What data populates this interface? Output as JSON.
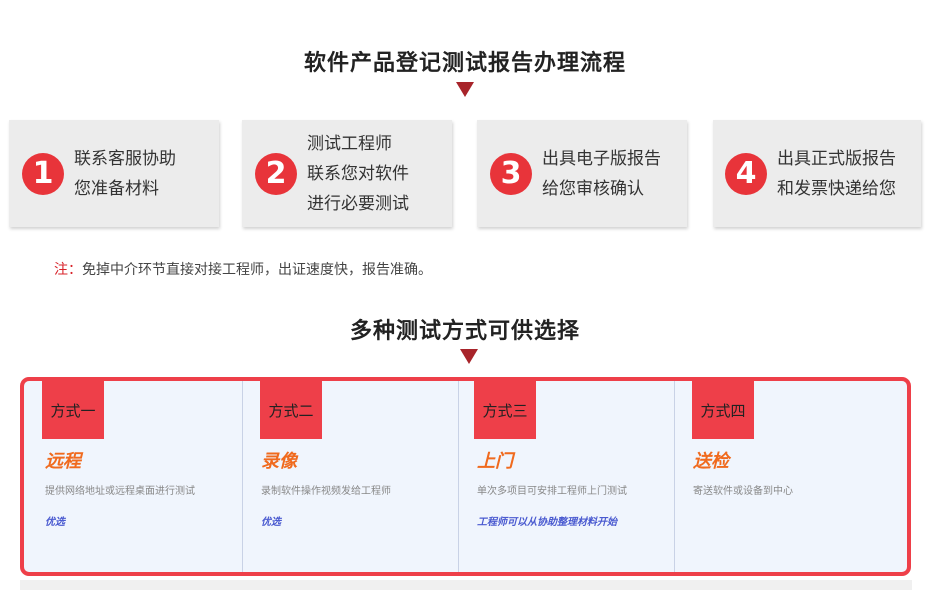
{
  "process": {
    "title": "软件产品登记测试报告办理流程",
    "steps": [
      {
        "number": "1",
        "lines": [
          "联系客服协助",
          "您准备材料"
        ]
      },
      {
        "number": "2",
        "lines": [
          "测试工程师",
          "联系您对软件",
          "进行必要测试"
        ]
      },
      {
        "number": "3",
        "lines": [
          "出具电子版报告",
          "给您审核确认"
        ]
      },
      {
        "number": "4",
        "lines": [
          "出具正式版报告",
          "和发票快递给您"
        ]
      }
    ],
    "note": {
      "mark": "注：",
      "text": "免掉中介环节直接对接工程师，出证速度快，报告准确。"
    }
  },
  "methods": {
    "title": "多种测试方式可供选择",
    "items": [
      {
        "tag": "方式一",
        "title": "远程",
        "desc": "提供网络地址或远程桌面进行测试",
        "highlight": "优选"
      },
      {
        "tag": "方式二",
        "title": "录像",
        "desc": "录制软件操作视频发给工程师",
        "highlight": "优选"
      },
      {
        "tag": "方式三",
        "title": "上门",
        "desc": "单次多项目可安排工程师上门测试",
        "highlight": "工程师可以从协助整理材料开始"
      },
      {
        "tag": "方式四",
        "title": "送检",
        "desc": "寄送软件或设备到中心",
        "highlight": ""
      }
    ]
  },
  "colors": {
    "accent_red": "#ee3f49",
    "arrow_dark_red": "#a8242a",
    "method_title_orange": "#f06a1e",
    "highlight_blue": "#4a5ad0"
  }
}
